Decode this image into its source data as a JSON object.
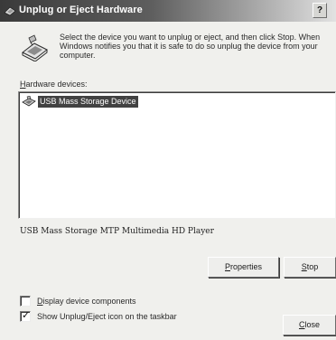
{
  "window": {
    "title": "Unplug or Eject Hardware",
    "help_label": "?"
  },
  "intro": {
    "text": "Select the device you want to unplug or eject, and then click Stop. When Windows notifies you that it is safe to do so unplug the device from your computer."
  },
  "hardware_devices": {
    "label_accel": "H",
    "label_rest": "ardware devices:",
    "items": [
      {
        "label": "USB Mass Storage Device",
        "selected": true
      }
    ]
  },
  "device_description": "USB Mass Storage MTP Multimedia HD Player",
  "buttons": {
    "properties_accel": "P",
    "properties_rest": "roperties",
    "stop_accel": "S",
    "stop_rest": "top",
    "close_accel": "C",
    "close_rest": "lose"
  },
  "options": {
    "display_components_accel": "D",
    "display_components_rest": "isplay device components",
    "display_components_checked": false,
    "show_icon_label": "Show Unplug/Eject icon on the taskbar",
    "show_icon_checked": true,
    "checkmark_glyph": "✓"
  },
  "colors": {
    "selection": "#424242",
    "title_gradient_start": "#3a3a3a",
    "title_gradient_end": "#e2e2e2"
  }
}
